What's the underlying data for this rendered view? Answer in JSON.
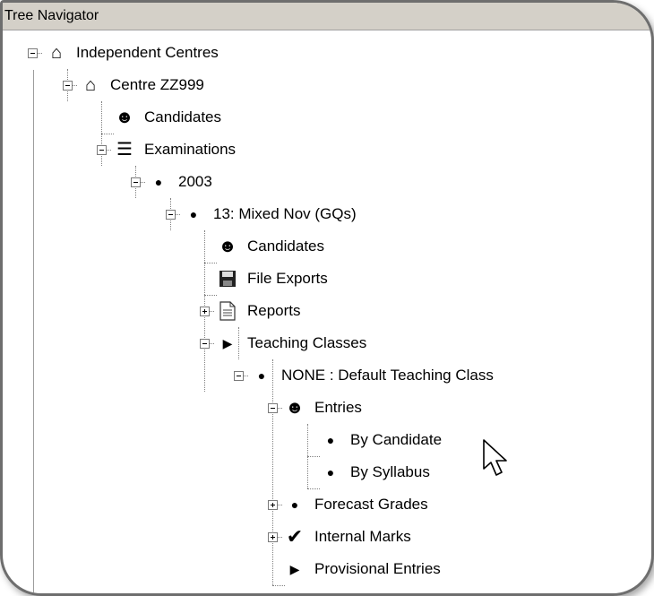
{
  "window": {
    "title": "Tree Navigator"
  },
  "tree": {
    "items": [
      {
        "label": "Independent Centres",
        "icon": "house-icon",
        "expander": "expanded"
      },
      {
        "label": "Centre ZZ999",
        "icon": "house-icon",
        "expander": "expanded"
      },
      {
        "label": "Candidates",
        "icon": "candidates-icon",
        "expander": "none"
      },
      {
        "label": "Examinations",
        "icon": "books-icon",
        "expander": "expanded"
      },
      {
        "label": "2003",
        "icon": "bullet-icon",
        "expander": "expanded"
      },
      {
        "label": "13: Mixed Nov (GQs)",
        "icon": "bullet-icon",
        "expander": "expanded"
      },
      {
        "label": "Candidates",
        "icon": "candidates-icon",
        "expander": "none"
      },
      {
        "label": "File Exports",
        "icon": "floppy-disk-icon",
        "expander": "none"
      },
      {
        "label": "Reports",
        "icon": "document-icon",
        "expander": "collapsed"
      },
      {
        "label": "Teaching Classes",
        "icon": "triangle-right-icon",
        "expander": "expanded"
      },
      {
        "label": "NONE : Default Teaching Class",
        "icon": "bullet-icon",
        "expander": "expanded"
      },
      {
        "label": "Entries",
        "icon": "candidates-icon",
        "expander": "expanded"
      },
      {
        "label": "By Candidate",
        "icon": "bullet-icon",
        "expander": "none"
      },
      {
        "label": "By Syllabus",
        "icon": "bullet-icon",
        "expander": "none"
      },
      {
        "label": "Forecast Grades",
        "icon": "bullet-icon",
        "expander": "collapsed"
      },
      {
        "label": "Internal Marks",
        "icon": "checkmark-icon",
        "expander": "collapsed"
      },
      {
        "label": "Provisional Entries",
        "icon": "triangle-right-icon",
        "expander": "none"
      }
    ]
  }
}
